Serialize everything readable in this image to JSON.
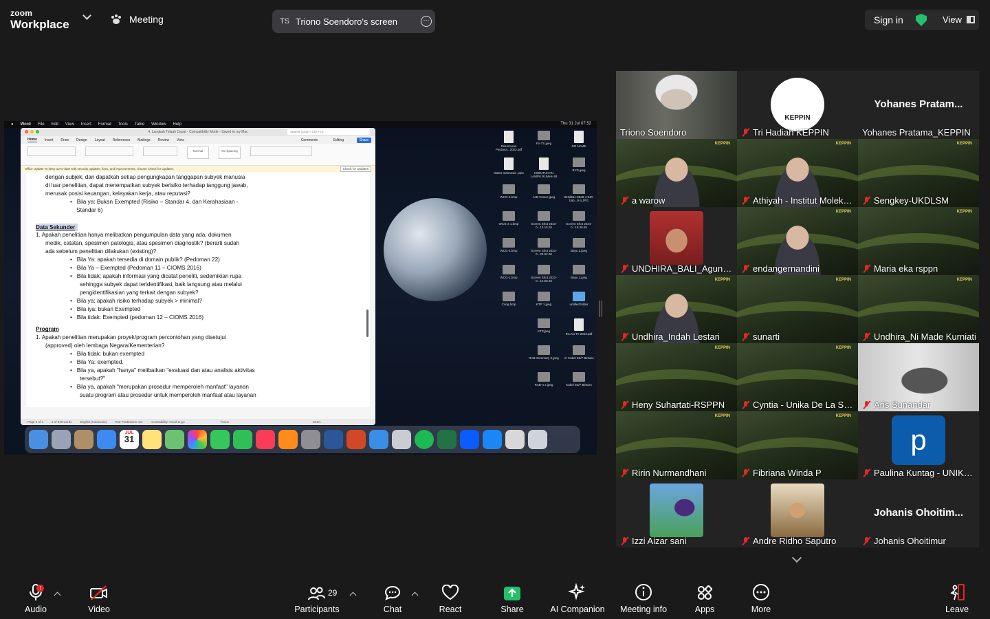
{
  "app": {
    "brand_line1": "zoom",
    "brand_line2": "Workplace",
    "meeting_label": "Meeting"
  },
  "share_banner": {
    "initials": "TS",
    "label": "Triono Soendoro's screen"
  },
  "top_right": {
    "sign_in": "Sign in",
    "view": "View"
  },
  "shared_screen": {
    "menubar": [
      "Word",
      "File",
      "Edit",
      "View",
      "Insert",
      "Format",
      "Tools",
      "Table",
      "Window",
      "Help"
    ],
    "clock": "Thu 31 Jul  07.52",
    "word": {
      "title": "4. Langkah Telaah Cepat  -  Compatibility Mode  -  Saved to my Mac",
      "search_placeholder": "Search (Cmd + Ctrl + U)",
      "tabs": [
        "Home",
        "Insert",
        "Draw",
        "Design",
        "Layout",
        "References",
        "Mailings",
        "Review",
        "View"
      ],
      "share_btn": "Share",
      "comments": "Comments",
      "editing": "Editing",
      "style_normal": "Normal",
      "style_nospacing": "No Spacing",
      "update_text": "Office Update  To keep up-to-date with security updates, fixes, and improvements, choose Check for Updates.",
      "update_btn": "Check for Updates",
      "doc": {
        "p1": "dengan subjek; dan dapatkah setiap pengungkapan tanggapan subyek manusia",
        "p2": "di luar penelitian, dapat menempatkan subyek berisiko terhadap tanggung jawab,",
        "p3": "merusak posisi keuangan, kelayakan kerja, atau reputasi?",
        "p4": "Bila ya: Bukan Exempted (Risiko – Standar 4, dan Kerahasiaan -",
        "p5": "Standar 6)",
        "h1": "Data Sekunder",
        "q1a": "1.    Apakah penelitian hanya melibatkan pengumpulan data yang ada, dokumen",
        "q1b": "medik, catatan, spesimen patologis, atau spesimen diagnostik? (berarti sudah",
        "q1c": "ada sebelum penelitian dilakukan (existing)?",
        "b1": "Bila Ya: apakah tersedia di domain publik? (Pedoman 22)",
        "b2": "Bila Ya – Exempted (Pedoman 11 – CIOMS 2016)",
        "b3a": "Bila tidak; apakah informasi yang dicatat peneliti, sedemikian rupa",
        "b3b": "sehingga subyek dapat teridentifikasi, baik langsung atau melalui",
        "b3c": "pengidentifikasian yang terkait dengan subyek?",
        "b4": "Bila ya; apakah risiko terhadap subyek > minimal?",
        "b5": "Bila iya: bukan Exempted",
        "b6": "Bila tidak: Exempted (pedoman 12 – CIOMS 2016)",
        "h2": "Program",
        "r1a": "1.    Apakah penelitian merupakan proyek/program percontohan yang disetujui",
        "r1b": "(approved) oleh lembaga Negara/Kementerian?",
        "c1": "Bila tidak: bukan exempted",
        "c2": "Bila Ya: exempted.",
        "c3a": "Bila ya, apakah \"hanya\" melibatkan \"evaluasi dan atau analisis aktivitas",
        "c3b": "tersebut?\"",
        "c4a": "Bila ya, apakah \"merupakan prosedur memperoleh manfaat\" layanan",
        "c4b": "suatu program atau prosedur untuk memperoleh manfaat atau layanan"
      },
      "status": [
        "Page 3 of 4",
        "2 of 946 words",
        "English (Indonesia)",
        "Text Predictions: On",
        "Accessibility: Good to go",
        "Focus",
        "181%"
      ]
    },
    "desktop_files": [
      "Peluncuran Perdana...2022.pdf",
      "Fir-TS.jpeg",
      "NO NAME",
      "Gates Indonesia .pptx",
      "KEBUTUHAN LAMPU RUMAH IB",
      "BYD.jpeg",
      "WCG-4.bmp",
      "AJB Cinere.jpeg",
      "821d61c-95d8-4 540-bab...9-3.JPG",
      "WCG-3 1.bmp",
      "Screen Shot 2023-0...13.15.25",
      "Screen Shot 2024-0...18.36.55",
      "WCG-2.bmp",
      "Screen Shot 2023-0...23.02.00",
      "Bayu 2.jpeg",
      "WCG-1.bmp",
      "Screen Shot 2023-0...14.50.20",
      "Bayu 1.jpeg",
      "Cong.bmp",
      "KTP 1.jpeg",
      "untitled folder",
      "KTP.jpeg",
      "IKLAN TA-2023.pdf",
      "RAB-Summary 3.jpeg",
      "Jl. Kabel E6/7 Bintaro",
      "RAB-4 2.jpeg",
      "Kabel E6/7 Bintaro"
    ],
    "dock_date": {
      "month": "JUL",
      "day": "31"
    }
  },
  "participants": [
    {
      "name": "Triono Soendoro",
      "kind": "video",
      "muted": false,
      "active": true
    },
    {
      "name": "Tri Hadiah KEPPIN",
      "kind": "logo",
      "logo_text": "KEPPIN",
      "muted": true
    },
    {
      "name": "Yohanes Pratama_KEPPIN",
      "kind": "name",
      "big": "Yohanes  Pratam...",
      "muted": false
    },
    {
      "name": "a warow",
      "kind": "keppin-video",
      "muted": true
    },
    {
      "name": "Athiyah - Institut Moleku...",
      "kind": "keppin-video",
      "muted": true
    },
    {
      "name": "Sengkey-UKDLSM",
      "kind": "keppin",
      "muted": true
    },
    {
      "name": "UNDHIRA_BALI_Agung ...",
      "kind": "photo",
      "muted": true
    },
    {
      "name": "endangernandini",
      "kind": "keppin-video",
      "muted": true
    },
    {
      "name": "Maria eka rsppn",
      "kind": "keppin",
      "muted": true
    },
    {
      "name": "Undhira_Indah Lestari",
      "kind": "keppin-video",
      "muted": true
    },
    {
      "name": "sunarti",
      "kind": "keppin",
      "muted": true
    },
    {
      "name": "Undhira_Ni Made Kurniati",
      "kind": "keppin",
      "muted": true
    },
    {
      "name": "Heny Suhartati-RSPPN",
      "kind": "keppin",
      "muted": true
    },
    {
      "name": "Cyntia - Unika De La Sall...",
      "kind": "keppin",
      "muted": true
    },
    {
      "name": "Aris Sunandar",
      "kind": "video-light",
      "muted": true
    },
    {
      "name": "Ririn Nurmandhani",
      "kind": "keppin",
      "muted": true
    },
    {
      "name": "Fibriana Winda P",
      "kind": "keppin",
      "muted": true
    },
    {
      "name": "Paulina Kuntag - UNIKA ...",
      "kind": "avatar",
      "avatar_letter": "p",
      "muted": true
    },
    {
      "name": "Izzi Aizar sani",
      "kind": "photo-sky",
      "muted": true
    },
    {
      "name": "Andre Ridho Saputro",
      "kind": "photo-room",
      "muted": true
    },
    {
      "name": "Johanis Ohoitimur",
      "kind": "name",
      "big": "Johanis  Ohoitim...",
      "muted": true
    }
  ],
  "toolbar": {
    "audio": "Audio",
    "audio_badge": "!",
    "video": "Video",
    "participants": "Participants",
    "participants_count": "29",
    "chat": "Chat",
    "react": "React",
    "share": "Share",
    "ai": "AI Companion",
    "info": "Meeting info",
    "apps": "Apps",
    "more": "More",
    "leave": "Leave"
  },
  "colors": {
    "share_green": "#23c16b",
    "muted_red": "#e02828",
    "active_outline": "#2bd672",
    "avatar_blue": "#0b5cad"
  }
}
